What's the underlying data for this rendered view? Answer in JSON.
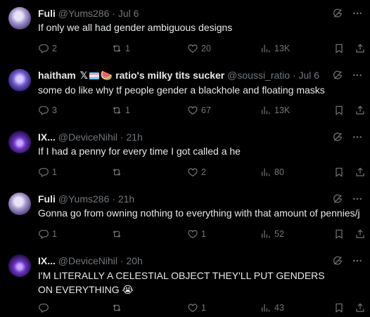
{
  "tweets": [
    {
      "name": "Fuli",
      "handle": "@Yums286",
      "time": "· Jul 6",
      "text": "If only we all had gender ambiguous designs",
      "replies": "2",
      "retweets": "1",
      "likes": "20",
      "views": "13K"
    },
    {
      "name": "haitham",
      "name_suffix": "ratio's milky tits sucker",
      "badge_x": "𝕏",
      "badge_emoji": "🍉",
      "handle": "@soussi_ratio",
      "time": "· Jul 6",
      "text": "some do like why tf people gender a blackhole and floating masks",
      "replies": "3",
      "retweets": "1",
      "likes": "67",
      "views": "13K"
    },
    {
      "name": "IX...",
      "handle": "@DeviceNihil",
      "time": "· 21h",
      "text": "If I had a penny for every time I got called a he",
      "replies": "1",
      "retweets": "",
      "likes": "2",
      "views": "80"
    },
    {
      "name": "Fuli",
      "handle": "@Yums286",
      "time": "· 21h",
      "text": "Gonna go from owning nothing to everything with that amount of pennies/j",
      "replies": "1",
      "retweets": "",
      "likes": "1",
      "views": "52"
    },
    {
      "name": "IX...",
      "handle": "@DeviceNihil",
      "time": "· 20h",
      "text": "I'M LITERALLY A CELESTIAL OBJECT THEY'LL PUT GENDERS ON EVERYTHING 😭",
      "replies": "",
      "retweets": "",
      "likes": "1",
      "views": "43"
    }
  ],
  "icons": {
    "reply": "reply-icon",
    "retweet": "retweet-icon",
    "like": "heart-icon",
    "views": "views-icon",
    "bookmark": "bookmark-icon",
    "share": "share-icon",
    "grok": "grok-icon",
    "more": "more-icon"
  },
  "colors": {
    "background": "#000000",
    "text": "#e7e9ea",
    "muted": "#71767b"
  }
}
